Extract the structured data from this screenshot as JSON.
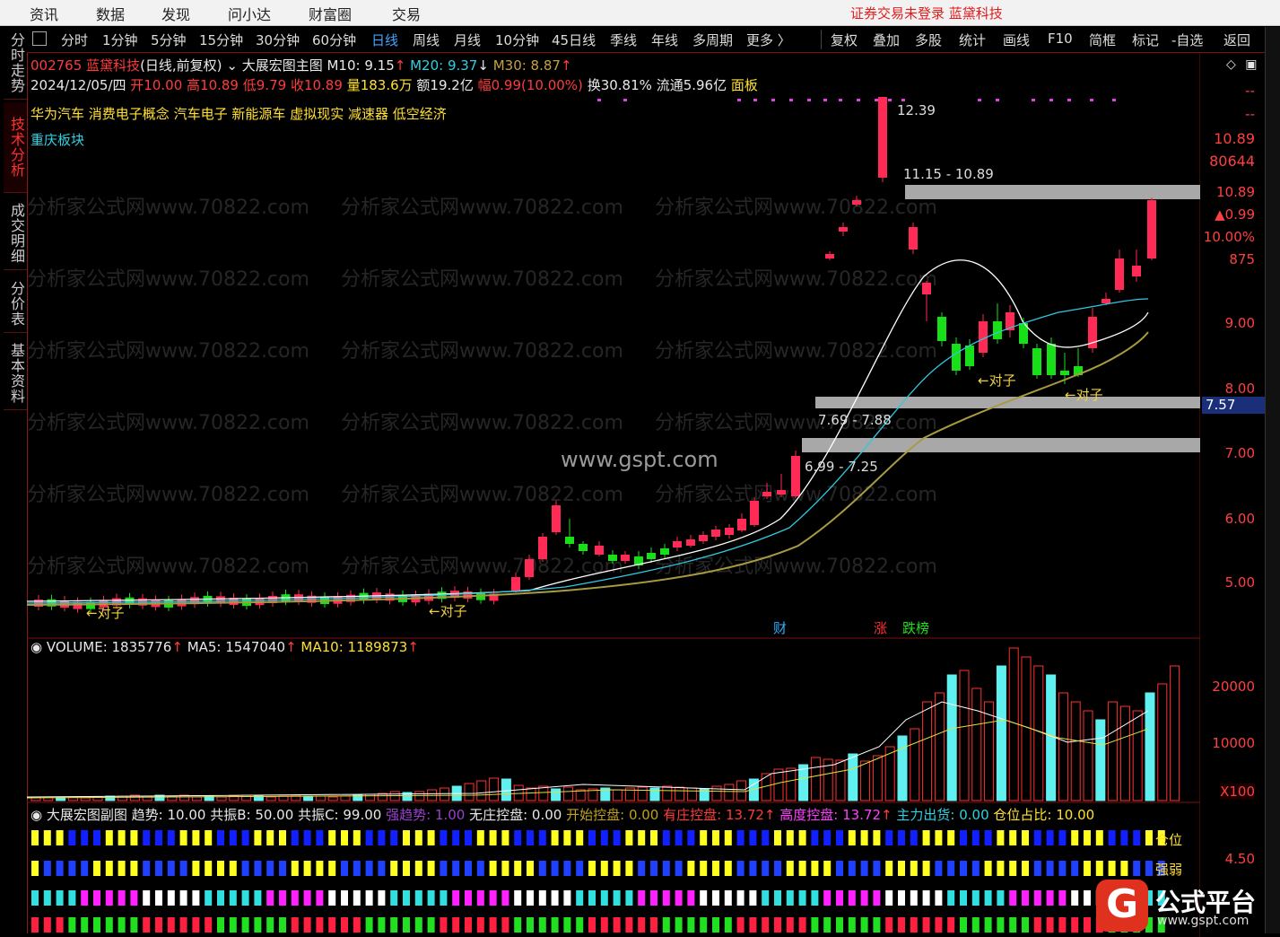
{
  "top_menu": {
    "items": [
      "资讯",
      "数据",
      "发现",
      "问小达",
      "财富圈",
      "交易"
    ],
    "status": "证券交易未登录  蓝黛科技"
  },
  "side_tabs": [
    "分时走势",
    "技术分析",
    "成交明细",
    "分价表",
    "基本资料"
  ],
  "periods": [
    "分时",
    "1分钟",
    "5分钟",
    "15分钟",
    "30分钟",
    "60分钟",
    "日线",
    "周线",
    "月线",
    "10分钟",
    "45日线",
    "季线",
    "年线",
    "多周期",
    "更多 〉"
  ],
  "active_period": "日线",
  "tools": [
    "复权",
    "叠加",
    "多股",
    "统计",
    "画线",
    "F10",
    "简框",
    "标记",
    "-自选",
    "返回"
  ],
  "stock": {
    "code": "002765",
    "name": "蓝黛科技",
    "mode": "(日线,前复权)",
    "indicator": "大展宏图主图",
    "m10": "M10: 9.15",
    "m20": "M20: 9.37",
    "m30": "M30: 8.87",
    "date": "2024/12/05/四",
    "open": "开10.00",
    "high": "高10.89",
    "low": "低9.79",
    "close": "收10.89",
    "volume": "量183.6万",
    "amount": "额19.2亿",
    "change": "幅0.99(10.00%)",
    "turnover": "换30.81%",
    "float_cap": "流通5.96亿",
    "board": "面板"
  },
  "concepts": [
    "华为汽车",
    "消费电子概念",
    "汽车电子",
    "新能源车",
    "虚拟现实",
    "减速器",
    "低空经济"
  ],
  "region": "重庆板块",
  "right_panel": {
    "dash1": "--",
    "dash2": "--",
    "price": "10.89",
    "vol": "80644",
    "last": "10.89",
    "chg": "▲0.99",
    "pct": "10.00%",
    "hand": "875",
    "current_marker": "7.57"
  },
  "price_axis": [
    "9.00",
    "8.00",
    "7.00",
    "6.00",
    "5.00"
  ],
  "annotations": {
    "high": "12.39",
    "zone_top": "11.15 - 10.89",
    "zone_mid": "7.69 - 7.88",
    "zone_low": "6.99 - 7.25",
    "pair1": "←对子",
    "pair2": "←对子",
    "pair3": "←对子",
    "pair4": "←对子",
    "tag_cai": "财",
    "tag_zhang": "涨",
    "tag_bang": "跌榜"
  },
  "volume_panel": {
    "title": "VOLUME: 1835776",
    "ma5": "MA5: 1547040",
    "ma10": "MA10: 1189873",
    "axis": [
      "20000",
      "10000"
    ],
    "unit": "X100"
  },
  "sub_panel": {
    "title": "大展宏图副图",
    "trend": "趋势: 10.00",
    "resB": "共振B: 50.00",
    "resC": "共振C: 99.00",
    "strong": "强趋势: 1.00",
    "no_control": "无庄控盘: 0.00",
    "start_control": "开始控盘: 0.00",
    "has_control": "有庄控盘: 13.72",
    "high_control": "高度控盘: 13.72",
    "main_out": "主力出货: 0.00",
    "position": "仓位占比: 10.00",
    "row1_label": "仓位",
    "row2_label": "强弱",
    "axis": "4.50"
  },
  "watermark": "分析家公式网www.70822.com",
  "gspt": "www.gspt.com",
  "logo": {
    "text": "公式平台",
    "url": "www.gspt.com"
  },
  "colors": {
    "up": "#ff2a55",
    "down": "#18e018",
    "ma_white": "#ffffff",
    "ma_cyan": "#30c8e0",
    "ma_olive": "#a89a40",
    "zone": "#a8a8a8"
  }
}
